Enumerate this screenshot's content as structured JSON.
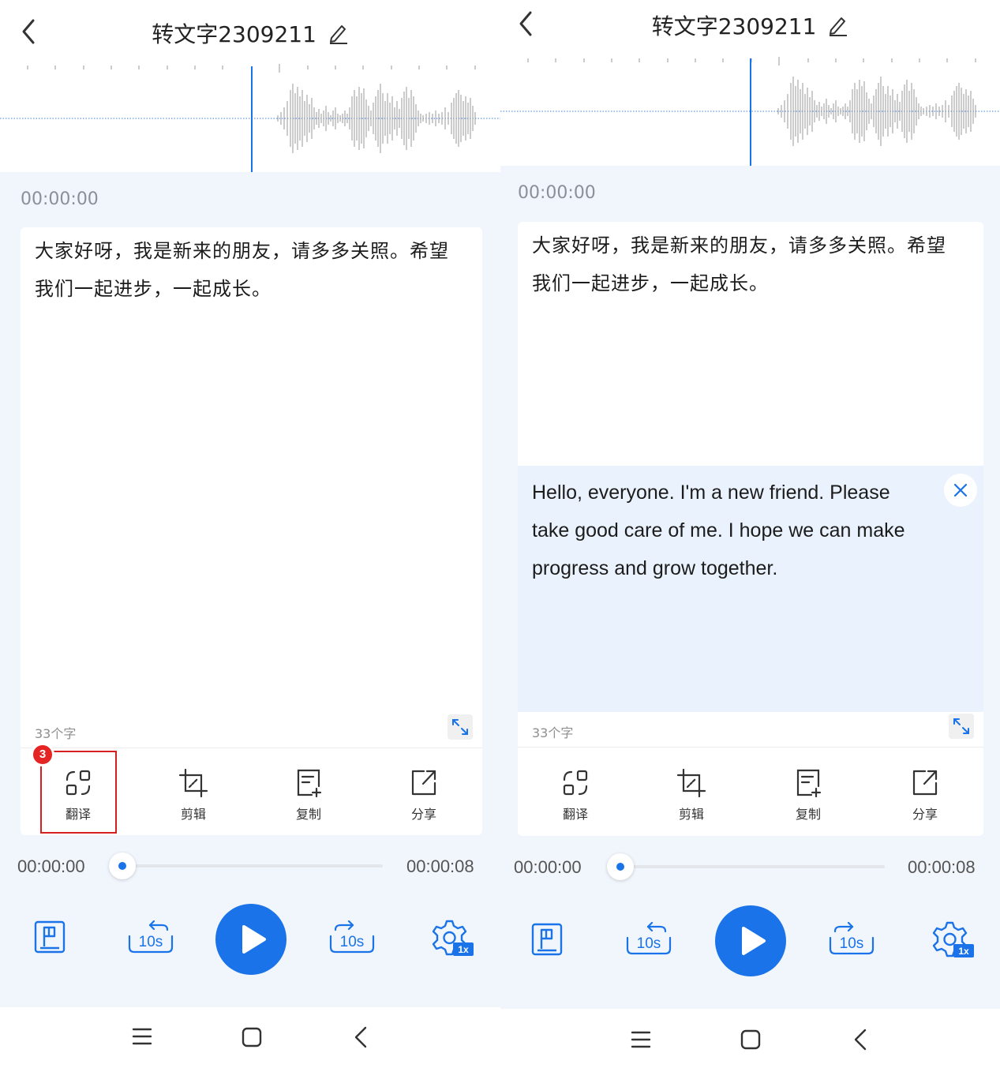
{
  "colors": {
    "accent": "#1a73e8",
    "content_bg": "#f1f6fd",
    "translation_bg": "#eaf2fd",
    "highlight": "#d6201f"
  },
  "header": {
    "title": "转文字2309211"
  },
  "recording": {
    "current_time": "00:00:00",
    "transcript": [
      "大家好呀，我是新来的朋友，请多多关照。希望",
      "我们一起进步，一起成长。"
    ],
    "translation": [
      "Hello, everyone. I'm a new friend. Please",
      "take good care of me. I hope we can make",
      "progress and grow together."
    ],
    "char_count": "33个字"
  },
  "toolbar": {
    "translate": "翻译",
    "edit": "剪辑",
    "copy": "复制",
    "share": "分享"
  },
  "annotation": {
    "step_badge": "3"
  },
  "player": {
    "start_time": "00:00:00",
    "end_time": "00:00:08",
    "progress": 0.0,
    "rewind_label": "10s",
    "forward_label": "10s",
    "speed_label": "1x"
  },
  "icons": [
    "back-icon",
    "edit-pencil-icon",
    "close-icon",
    "expand-icon",
    "translate-icon",
    "crop-icon",
    "copy-icon",
    "share-icon",
    "bookmark-icon",
    "rewind-10s-icon",
    "play-icon",
    "forward-10s-icon",
    "speed-settings-icon",
    "menu-icon",
    "home-icon",
    "nav-back-icon"
  ]
}
